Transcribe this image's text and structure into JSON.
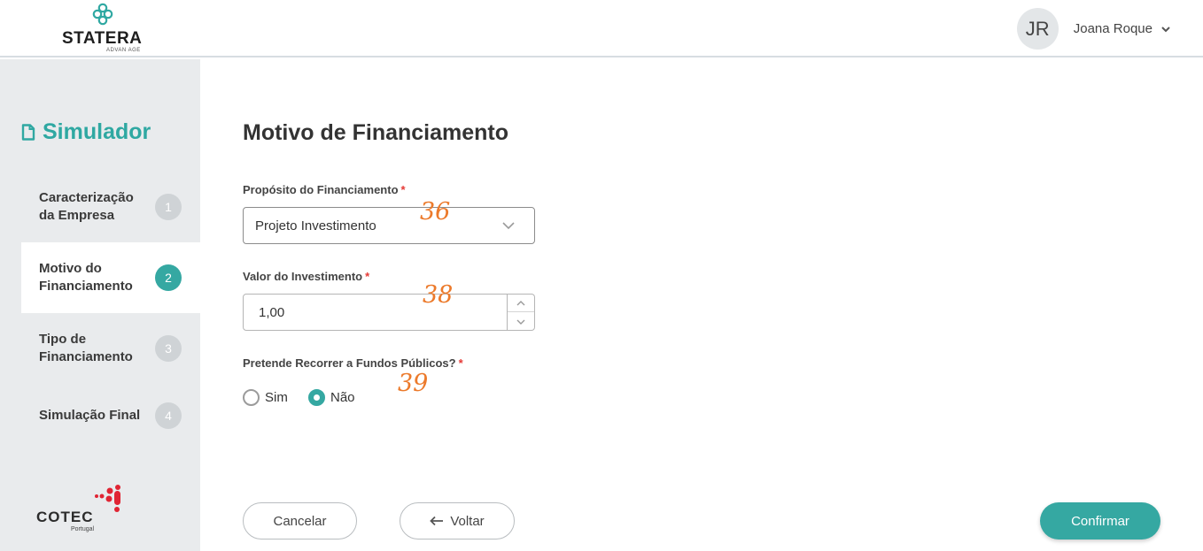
{
  "header": {
    "logo_text": "STATERA",
    "logo_subtext": "ADVAN AGE",
    "user": {
      "initials": "JR",
      "name": "Joana Roque"
    }
  },
  "sidebar": {
    "title": "Simulador",
    "steps": [
      {
        "label": "Caracterização da Empresa",
        "number": "1",
        "active": false
      },
      {
        "label": "Motivo do Financiamento",
        "number": "2",
        "active": true
      },
      {
        "label": "Tipo de Financiamento",
        "number": "3",
        "active": false
      },
      {
        "label": "Simulação Final",
        "number": "4",
        "active": false
      }
    ],
    "footer_logo": {
      "text": "COTEC",
      "subtext": "Portugal"
    }
  },
  "main": {
    "title": "Motivo de Financiamento",
    "purpose": {
      "label": "Propósito do Financiamento",
      "required_mark": "*",
      "value": "Projeto Investimento"
    },
    "investment": {
      "label": "Valor do Investimento",
      "required_mark": "*",
      "value": "1,00"
    },
    "public_funds": {
      "label": "Pretende Recorrer a Fundos Públicos?",
      "required_mark": "*",
      "options": [
        {
          "label": "Sim",
          "checked": false
        },
        {
          "label": "Não",
          "checked": true
        }
      ]
    },
    "annotations": [
      "36",
      "38",
      "39"
    ]
  },
  "buttons": {
    "cancel": "Cancelar",
    "back": "Voltar",
    "confirm": "Confirmar"
  },
  "colors": {
    "accent": "#35a8a2",
    "sidebar_bg": "#e9ebed",
    "annotation": "#ec7a2b",
    "required": "#e53935"
  }
}
